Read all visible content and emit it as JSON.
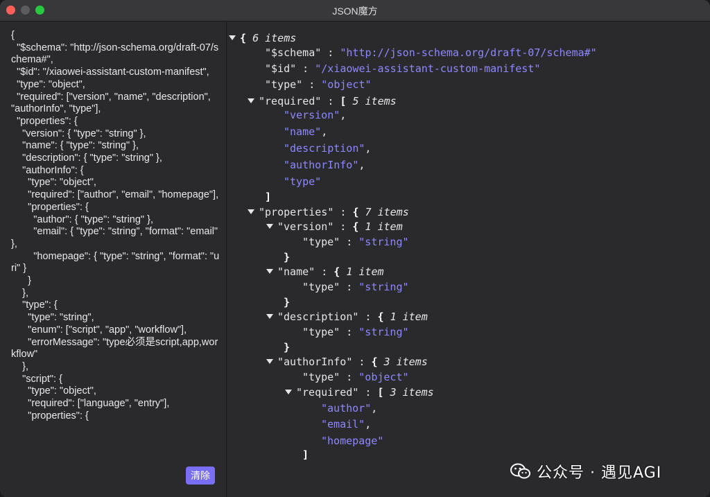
{
  "window": {
    "title": "JSON魔方"
  },
  "input": {
    "lines": [
      "{",
      "  \"$schema\": \"http://json-schema.org/draft-07/schema#\",",
      "  \"$id\": \"/xiaowei-assistant-custom-manifest\",",
      "  \"type\": \"object\",",
      "  \"required\": [\"version\", \"name\", \"description\", \"authorInfo\", \"type\"],",
      "  \"properties\": {",
      "    \"version\": { \"type\": \"string\" },",
      "    \"name\": { \"type\": \"string\" },",
      "    \"description\": { \"type\": \"string\" },",
      "    \"authorInfo\": {",
      "      \"type\": \"object\",",
      "      \"required\": [\"author\", \"email\", \"homepage\"],",
      "      \"properties\": {",
      "        \"author\": { \"type\": \"string\" },",
      "        \"email\": { \"type\": \"string\", \"format\": \"email\" },",
      "        \"homepage\": { \"type\": \"string\", \"format\": \"uri\" }",
      "      }",
      "    },",
      "    \"type\": {",
      "      \"type\": \"string\",",
      "      \"enum\": [\"script\", \"app\", \"workflow\"],",
      "      \"errorMessage\": \"type必须是script,app,workflow\"",
      "    },",
      "    \"script\": {",
      "      \"type\": \"object\",",
      "      \"required\": [\"language\", \"entry\"],",
      "      \"properties\": {"
    ],
    "clear_label": "清除"
  },
  "tree": {
    "rows": [
      {
        "indent": 0,
        "toggle": true,
        "key": "",
        "open": "{",
        "count": "6 items",
        "value": "",
        "comma": ""
      },
      {
        "indent": 1,
        "toggle": false,
        "key": "\"$schema\"",
        "open": "",
        "count": "",
        "value": "\"http://json-schema.org/draft-07/schema#\"",
        "comma": ""
      },
      {
        "indent": 1,
        "toggle": false,
        "key": "\"$id\"",
        "open": "",
        "count": "",
        "value": "\"/xiaowei-assistant-custom-manifest\"",
        "comma": ""
      },
      {
        "indent": 1,
        "toggle": false,
        "key": "\"type\"",
        "open": "",
        "count": "",
        "value": "\"object\"",
        "comma": ""
      },
      {
        "indent": 1,
        "toggle": true,
        "key": "\"required\"",
        "open": "[",
        "count": "5 items",
        "value": "",
        "comma": ""
      },
      {
        "indent": 2,
        "toggle": false,
        "key": "",
        "open": "",
        "count": "",
        "value": "\"version\"",
        "comma": ","
      },
      {
        "indent": 2,
        "toggle": false,
        "key": "",
        "open": "",
        "count": "",
        "value": "\"name\"",
        "comma": ","
      },
      {
        "indent": 2,
        "toggle": false,
        "key": "",
        "open": "",
        "count": "",
        "value": "\"description\"",
        "comma": ","
      },
      {
        "indent": 2,
        "toggle": false,
        "key": "",
        "open": "",
        "count": "",
        "value": "\"authorInfo\"",
        "comma": ","
      },
      {
        "indent": 2,
        "toggle": false,
        "key": "",
        "open": "",
        "count": "",
        "value": "\"type\"",
        "comma": ""
      },
      {
        "indent": 1,
        "toggle": false,
        "key": "",
        "open": "]",
        "count": "",
        "value": "",
        "comma": ""
      },
      {
        "indent": 1,
        "toggle": true,
        "key": "\"properties\"",
        "open": "{",
        "count": "7 items",
        "value": "",
        "comma": ""
      },
      {
        "indent": 2,
        "toggle": true,
        "key": "\"version\"",
        "open": "{",
        "count": "1 item",
        "value": "",
        "comma": ""
      },
      {
        "indent": 3,
        "toggle": false,
        "key": "\"type\"",
        "open": "",
        "count": "",
        "value": "\"string\"",
        "comma": ""
      },
      {
        "indent": 2,
        "toggle": false,
        "key": "",
        "open": "}",
        "count": "",
        "value": "",
        "comma": ""
      },
      {
        "indent": 2,
        "toggle": true,
        "key": "\"name\"",
        "open": "{",
        "count": "1 item",
        "value": "",
        "comma": ""
      },
      {
        "indent": 3,
        "toggle": false,
        "key": "\"type\"",
        "open": "",
        "count": "",
        "value": "\"string\"",
        "comma": ""
      },
      {
        "indent": 2,
        "toggle": false,
        "key": "",
        "open": "}",
        "count": "",
        "value": "",
        "comma": ""
      },
      {
        "indent": 2,
        "toggle": true,
        "key": "\"description\"",
        "open": "{",
        "count": "1 item",
        "value": "",
        "comma": ""
      },
      {
        "indent": 3,
        "toggle": false,
        "key": "\"type\"",
        "open": "",
        "count": "",
        "value": "\"string\"",
        "comma": ""
      },
      {
        "indent": 2,
        "toggle": false,
        "key": "",
        "open": "}",
        "count": "",
        "value": "",
        "comma": ""
      },
      {
        "indent": 2,
        "toggle": true,
        "key": "\"authorInfo\"",
        "open": "{",
        "count": "3 items",
        "value": "",
        "comma": ""
      },
      {
        "indent": 3,
        "toggle": false,
        "key": "\"type\"",
        "open": "",
        "count": "",
        "value": "\"object\"",
        "comma": ""
      },
      {
        "indent": 3,
        "toggle": true,
        "key": "\"required\"",
        "open": "[",
        "count": "3 items",
        "value": "",
        "comma": ""
      },
      {
        "indent": 4,
        "toggle": false,
        "key": "",
        "open": "",
        "count": "",
        "value": "\"author\"",
        "comma": ","
      },
      {
        "indent": 4,
        "toggle": false,
        "key": "",
        "open": "",
        "count": "",
        "value": "\"email\"",
        "comma": ","
      },
      {
        "indent": 4,
        "toggle": false,
        "key": "",
        "open": "",
        "count": "",
        "value": "\"homepage\"",
        "comma": ""
      },
      {
        "indent": 3,
        "toggle": false,
        "key": "",
        "open": "]",
        "count": "",
        "value": "",
        "comma": ""
      }
    ]
  },
  "watermark": {
    "text": "公众号 · 遇见AGI"
  },
  "colors": {
    "value": "#8e88ff",
    "button": "#7b6ef6",
    "background": "#2a2a2d"
  }
}
